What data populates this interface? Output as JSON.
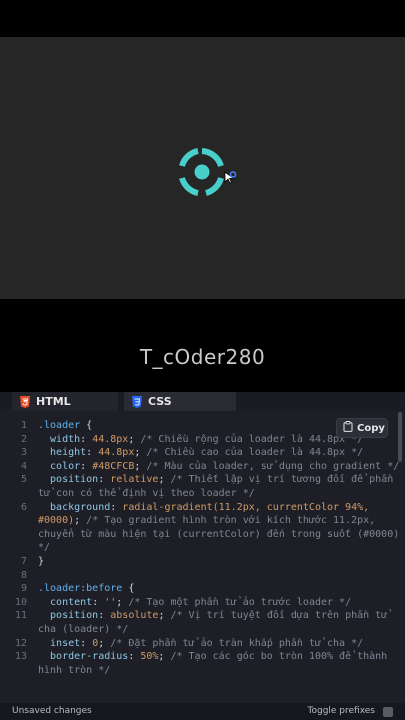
{
  "watermark": "T_cOder280",
  "preview": {
    "loader_color": "#48CFCB",
    "background": "#262626"
  },
  "tabs": [
    {
      "label": "HTML",
      "icon": "html5-icon",
      "color": "#e44d26",
      "active": false
    },
    {
      "label": "CSS",
      "icon": "css3-icon",
      "color": "#2965f1",
      "active": true
    }
  ],
  "copy_label": "Copy",
  "code_lines": [
    {
      "n": "1",
      "seg": [
        [
          "sel",
          ".loader"
        ],
        [
          "punc",
          " {"
        ]
      ]
    },
    {
      "n": "2",
      "seg": [
        [
          "prop",
          "  width"
        ],
        [
          "punc",
          ": "
        ],
        [
          "val",
          "44.8px"
        ],
        [
          "punc",
          "; "
        ],
        [
          "cmt",
          "/* Chiều rộng của loader là 44.8px */"
        ]
      ]
    },
    {
      "n": "3",
      "seg": [
        [
          "prop",
          "  height"
        ],
        [
          "punc",
          ": "
        ],
        [
          "val",
          "44.8px"
        ],
        [
          "punc",
          "; "
        ],
        [
          "cmt",
          "/* Chiều cao của loader là 44.8px */"
        ]
      ]
    },
    {
      "n": "4",
      "seg": [
        [
          "prop",
          "  color"
        ],
        [
          "punc",
          ": "
        ],
        [
          "val",
          "#48CFCB"
        ],
        [
          "punc",
          "; "
        ],
        [
          "cmt",
          "/* Màu của loader, sử dụng cho gradient */"
        ]
      ]
    },
    {
      "n": "5",
      "seg": [
        [
          "prop",
          "  position"
        ],
        [
          "punc",
          ": "
        ],
        [
          "val",
          "relative"
        ],
        [
          "punc",
          "; "
        ],
        [
          "cmt",
          "/* Thiết lập vị trí tương đối để phần"
        ]
      ]
    },
    {
      "n": "",
      "seg": [
        [
          "cmt",
          "tử con có thể định vị theo loader */"
        ]
      ]
    },
    {
      "n": "6",
      "seg": [
        [
          "prop",
          "  background"
        ],
        [
          "punc",
          ": "
        ],
        [
          "val",
          "radial-gradient(11.2px, currentColor 94%,"
        ]
      ]
    },
    {
      "n": "",
      "seg": [
        [
          "val",
          "#0000)"
        ],
        [
          "punc",
          "; "
        ],
        [
          "cmt",
          "/* Tạo gradient hình tròn với kích thước 11.2px,"
        ]
      ]
    },
    {
      "n": "",
      "seg": [
        [
          "cmt",
          "chuyển từ màu hiện tại (currentColor) đến trong suốt (#0000)"
        ]
      ]
    },
    {
      "n": "",
      "seg": [
        [
          "cmt",
          "*/"
        ]
      ]
    },
    {
      "n": "7",
      "seg": [
        [
          "punc",
          "}"
        ]
      ]
    },
    {
      "n": "8",
      "seg": []
    },
    {
      "n": "9",
      "seg": [
        [
          "sel",
          ".loader:before"
        ],
        [
          "punc",
          " {"
        ]
      ]
    },
    {
      "n": "10",
      "seg": [
        [
          "prop",
          "  content"
        ],
        [
          "punc",
          ": "
        ],
        [
          "val",
          "''"
        ],
        [
          "punc",
          "; "
        ],
        [
          "cmt",
          "/* Tạo một phần tử ảo trước loader */"
        ]
      ]
    },
    {
      "n": "11",
      "seg": [
        [
          "prop",
          "  position"
        ],
        [
          "punc",
          ": "
        ],
        [
          "val",
          "absolute"
        ],
        [
          "punc",
          "; "
        ],
        [
          "cmt",
          "/* Vị trí tuyệt đối dựa trên phần tử"
        ]
      ]
    },
    {
      "n": "",
      "seg": [
        [
          "cmt",
          "cha (loader) */"
        ]
      ]
    },
    {
      "n": "12",
      "seg": [
        [
          "prop",
          "  inset"
        ],
        [
          "punc",
          ": "
        ],
        [
          "val",
          "0"
        ],
        [
          "punc",
          "; "
        ],
        [
          "cmt",
          "/* Đặt phần tử ảo tràn khắp phần tử cha */"
        ]
      ]
    },
    {
      "n": "13",
      "seg": [
        [
          "prop",
          "  border-radius"
        ],
        [
          "punc",
          ": "
        ],
        [
          "val",
          "50%"
        ],
        [
          "punc",
          "; "
        ],
        [
          "cmt",
          "/* Tạo các góc bo tròn 100% để thành"
        ]
      ]
    },
    {
      "n": "",
      "seg": [
        [
          "cmt",
          "hình tròn */"
        ]
      ]
    }
  ],
  "status": {
    "left": "Unsaved changes",
    "right": "Toggle prefixes"
  }
}
